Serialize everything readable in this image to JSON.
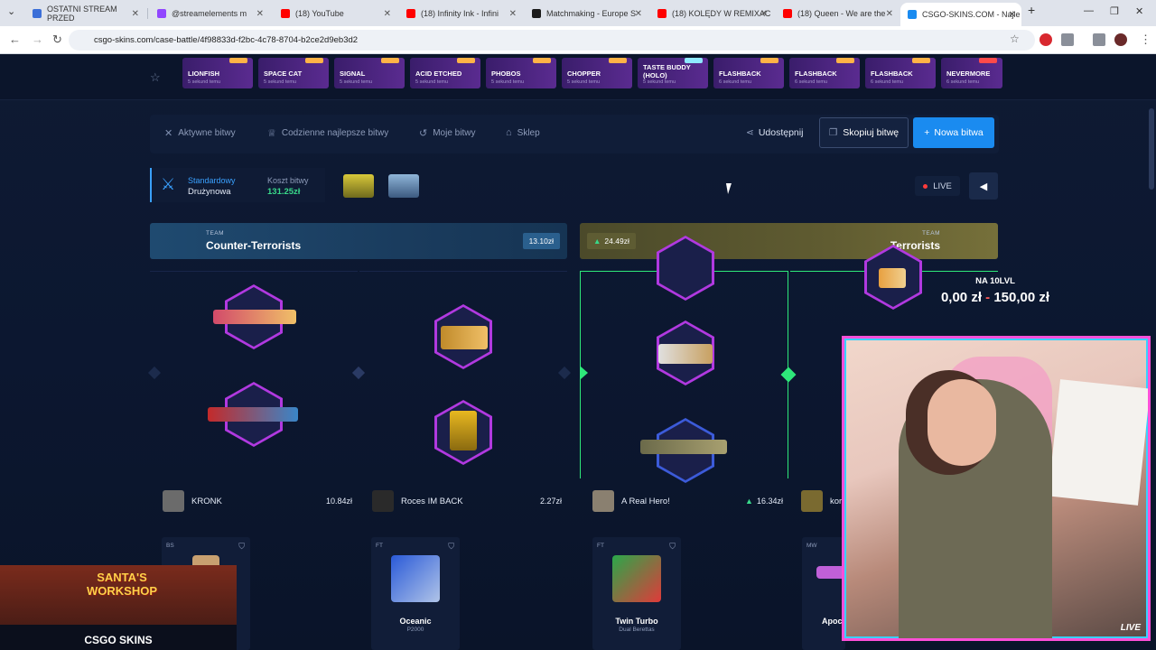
{
  "browser": {
    "tabs": [
      {
        "title": "OSTATNI STREAM PRZED",
        "color": "#3b6fd8"
      },
      {
        "title": "@streamelements m",
        "color": "#9146ff"
      },
      {
        "title": "(18) YouTube",
        "color": "#ff0000"
      },
      {
        "title": "(18) Infinity Ink - Infini",
        "color": "#ff0000"
      },
      {
        "title": "Matchmaking - Europe S",
        "color": "#1b1b1b"
      },
      {
        "title": "(18) KOLĘDY W REMIXAC",
        "color": "#ff0000"
      },
      {
        "title": "(18) Queen - We are the",
        "color": "#ff0000"
      },
      {
        "title": "CSGO-SKINS.COM - Najle",
        "color": "#1a8bf0"
      }
    ],
    "url": "csgo-skins.com/case-battle/4f98833d-f2bc-4c78-8704-b2ce2d9eb3d2"
  },
  "drops": [
    {
      "name": "LIONFISH",
      "sub": "5 sekund temu"
    },
    {
      "name": "SPACE CAT",
      "sub": "5 sekund temu"
    },
    {
      "name": "SIGNAL",
      "sub": "5 sekund temu"
    },
    {
      "name": "ACID ETCHED",
      "sub": "5 sekund temu"
    },
    {
      "name": "PHOBOS",
      "sub": "5 sekund temu"
    },
    {
      "name": "CHOPPER",
      "sub": "5 sekund temu"
    },
    {
      "name": "TASTE BUDDY (HOLO)",
      "sub": "5 sekund temu"
    },
    {
      "name": "FLASHBACK",
      "sub": "6 sekund temu"
    },
    {
      "name": "FLASHBACK",
      "sub": "6 sekund temu"
    },
    {
      "name": "FLASHBACK",
      "sub": "6 sekund temu"
    },
    {
      "name": "NEVERMORE",
      "sub": "6 sekund temu"
    }
  ],
  "subnav": {
    "active": "Aktywne bitwy",
    "daily": "Codzienne najlepsze bitwy",
    "mine": "Moje bitwy",
    "shop": "Sklep",
    "share": "Udostępnij",
    "copy": "Skopiuj bitwę",
    "new": "Nowa bitwa"
  },
  "mode": {
    "type_label": "Standardowy",
    "type_value": "Drużynowa",
    "cost_label": "Koszt bitwy",
    "cost_value": "131.25zł"
  },
  "live": "LIVE",
  "teams": {
    "ct": {
      "tag": "TEAM",
      "name": "Counter-Terrorists",
      "total": "13.10zł"
    },
    "t": {
      "tag": "TEAM",
      "name": "Terrorists",
      "total": "24.49zł"
    }
  },
  "players": [
    {
      "name": "KRONK",
      "value": "10.84zł"
    },
    {
      "name": "Roces IM BACK",
      "value": "2.27zł"
    },
    {
      "name": "A Real Hero!",
      "value": "16.34zł"
    },
    {
      "name": "kor",
      "value": ""
    }
  ],
  "wins": [
    {
      "cond": "BS",
      "name": "",
      "sub": ""
    },
    {
      "cond": "FT",
      "name": "Oceanic",
      "sub": "P2000"
    },
    {
      "cond": "FT",
      "name": "Twin Turbo",
      "sub": "Dual Berettas"
    },
    {
      "cond": "MW",
      "name": "Apoc",
      "sub": ""
    }
  ],
  "overlay": {
    "goal_title": "NA 10LVL",
    "goal_current": "0,00 zł",
    "goal_sep": "-",
    "goal_target": "150,00 zł",
    "cam_watermark": "LIVE"
  },
  "promo": {
    "title": "SANTA'S WORKSHOP",
    "brand": "CSGO SKINS"
  }
}
